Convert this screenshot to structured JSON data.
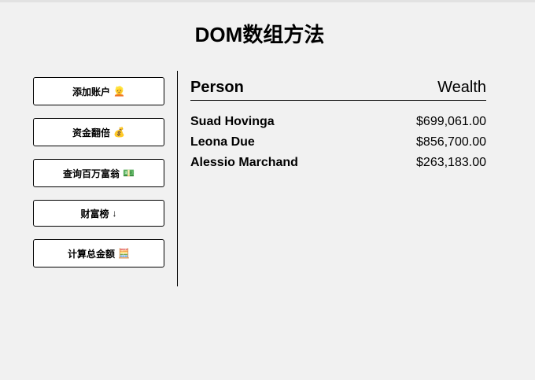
{
  "page": {
    "title": "DOM数组方法"
  },
  "sidebar": {
    "buttons": [
      {
        "label": "添加账户",
        "icon": "👱"
      },
      {
        "label": "资金翻倍",
        "icon": "💰"
      },
      {
        "label": "查询百万富翁",
        "icon": "💵"
      },
      {
        "label": "财富榜",
        "icon": "↓"
      },
      {
        "label": "计算总金额",
        "icon": "🧮"
      }
    ]
  },
  "table": {
    "headers": {
      "person": "Person",
      "wealth": "Wealth"
    },
    "rows": [
      {
        "name": "Suad Hovinga",
        "wealth": "$699,061.00"
      },
      {
        "name": "Leona Due",
        "wealth": "$856,700.00"
      },
      {
        "name": "Alessio Marchand",
        "wealth": "$263,183.00"
      }
    ]
  }
}
